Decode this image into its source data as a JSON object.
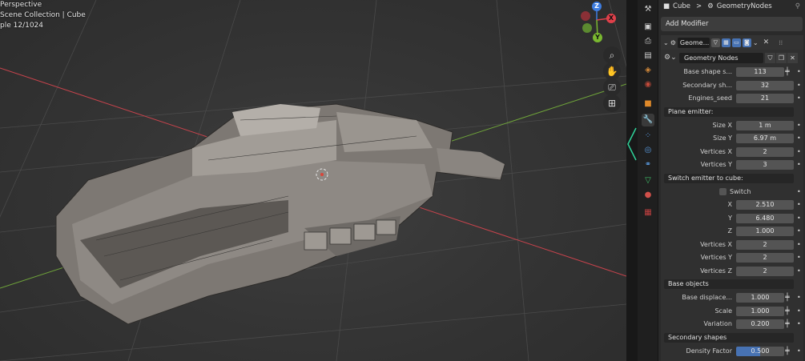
{
  "viewport": {
    "overlay_lines": [
      "Perspective",
      "Scene Collection | Cube",
      "ple 12/1024"
    ],
    "gizmo": {
      "z": "Z",
      "y": "Y",
      "x": "X"
    },
    "nav_icons": [
      "zoom-icon",
      "hand-pan-icon",
      "camera-icon",
      "grid-ortho-icon"
    ]
  },
  "props": {
    "breadcrumb_object": "Cube",
    "breadcrumb_sep": ">",
    "breadcrumb_modifier": "GeometryNodes",
    "add_modifier": "Add Modifier",
    "modifier_name": "Geome...",
    "nodegroup_name": "Geometry Nodes",
    "rows": {
      "base_shape_seed": {
        "label": "Base shape s...",
        "value": "113"
      },
      "secondary_seed": {
        "label": "Secondary sh...",
        "value": "32"
      },
      "engines_seed": {
        "label": "Engines_seed",
        "value": "21"
      },
      "plane_emitter": "Plane emitter:",
      "size_x": {
        "label": "Size X",
        "value": "1 m"
      },
      "size_y": {
        "label": "Size Y",
        "value": "6.97 m"
      },
      "vert_x1": {
        "label": "Vertices X",
        "value": "2"
      },
      "vert_y1": {
        "label": "Vertices Y",
        "value": "3"
      },
      "switch_emitter": "Switch emitter to cube:",
      "switch_label": "Switch",
      "x": {
        "label": "X",
        "value": "2.510"
      },
      "y": {
        "label": "Y",
        "value": "6.480"
      },
      "z": {
        "label": "Z",
        "value": "1.000"
      },
      "vert_x2": {
        "label": "Vertices X",
        "value": "2"
      },
      "vert_y2": {
        "label": "Vertices Y",
        "value": "2"
      },
      "vert_z2": {
        "label": "Vertices Z",
        "value": "2"
      },
      "base_objects": "Base objects",
      "base_displace": {
        "label": "Base displace...",
        "value": "1.000"
      },
      "scale": {
        "label": "Scale",
        "value": "1.000"
      },
      "variation": {
        "label": "Variation",
        "value": "0.200"
      },
      "secondary_shapes": "Secondary shapes",
      "density_factor": {
        "label": "Density Factor",
        "value": "0.500",
        "fill": 0.5
      }
    }
  },
  "colors": {
    "accent": "#4772b3",
    "x_axis": "#e0404a",
    "y_axis": "#7ab830",
    "z_axis": "#3e7de0"
  }
}
